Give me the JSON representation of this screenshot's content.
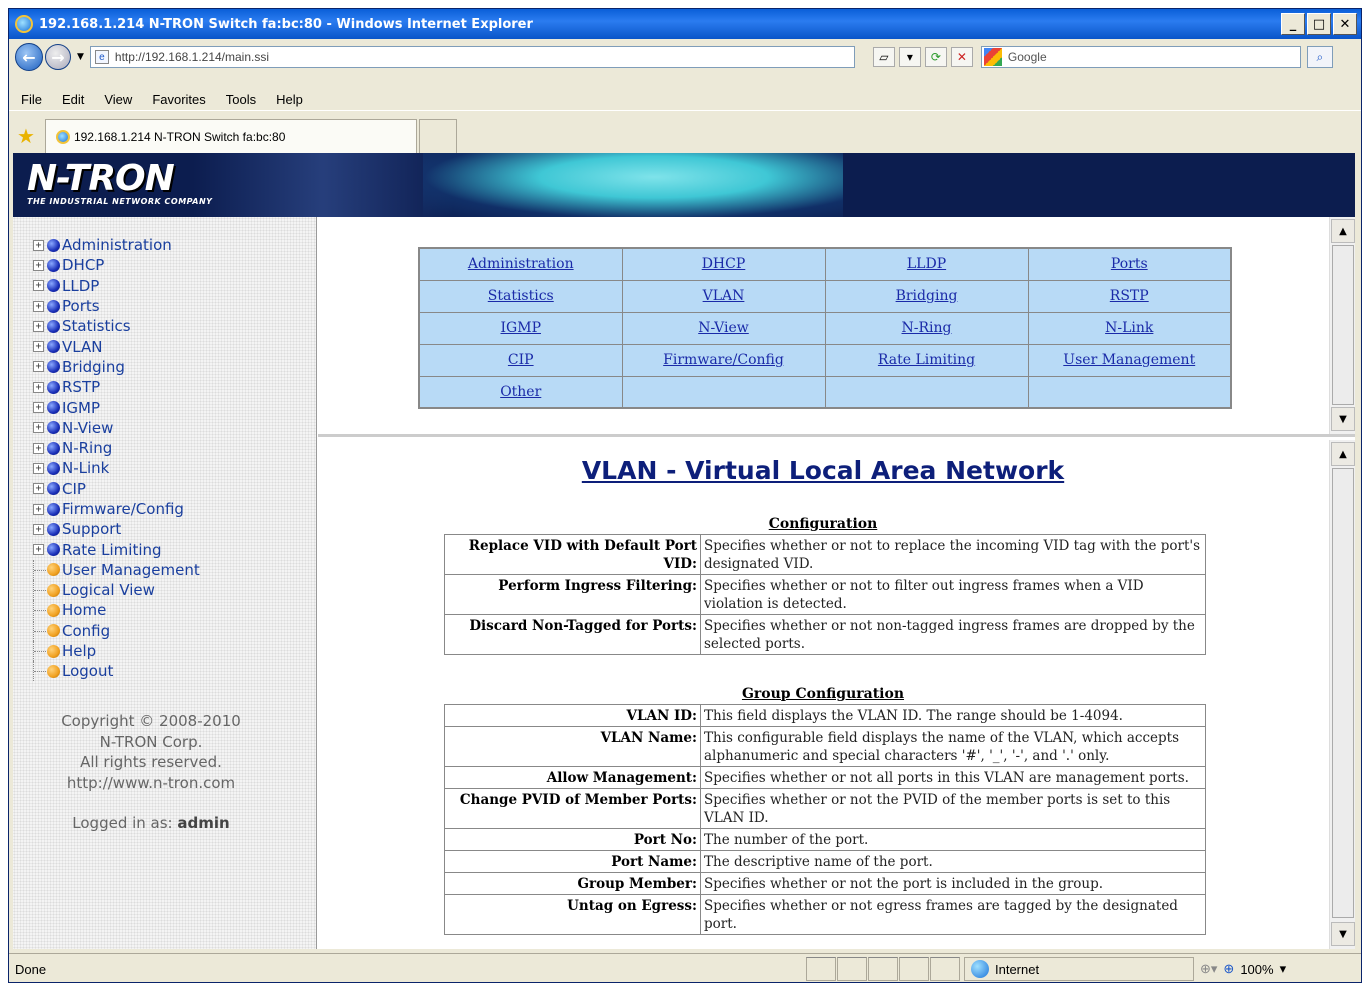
{
  "window": {
    "title": "192.168.1.214 N-TRON Switch fa:bc:80 - Windows Internet Explorer",
    "min_label": "_",
    "max_label": "□",
    "close_label": "✕"
  },
  "addressbar": {
    "back": "←",
    "forward": "→",
    "url": "http://192.168.1.214/main.ssi",
    "search_placeholder": "Google",
    "search_icon": "⌕"
  },
  "menu": [
    "File",
    "Edit",
    "View",
    "Favorites",
    "Tools",
    "Help"
  ],
  "tab": {
    "title": "192.168.1.214 N-TRON Switch fa:bc:80"
  },
  "brand": {
    "name": "N-TRON",
    "tagline": "THE INDUSTRIAL NETWORK COMPANY"
  },
  "sidebar": {
    "items": [
      {
        "label": "Administration",
        "icon": "blue-dot",
        "expandable": true
      },
      {
        "label": "DHCP",
        "icon": "blue-dot",
        "expandable": true
      },
      {
        "label": "LLDP",
        "icon": "blue-dot",
        "expandable": true
      },
      {
        "label": "Ports",
        "icon": "blue-dot",
        "expandable": true
      },
      {
        "label": "Statistics",
        "icon": "blue-dot",
        "expandable": true
      },
      {
        "label": "VLAN",
        "icon": "blue-dot",
        "expandable": true
      },
      {
        "label": "Bridging",
        "icon": "blue-dot",
        "expandable": true
      },
      {
        "label": "RSTP",
        "icon": "blue-dot",
        "expandable": true
      },
      {
        "label": "IGMP",
        "icon": "blue-dot",
        "expandable": true
      },
      {
        "label": "N-View",
        "icon": "blue-dot",
        "expandable": true
      },
      {
        "label": "N-Ring",
        "icon": "blue-dot",
        "expandable": true
      },
      {
        "label": "N-Link",
        "icon": "blue-dot",
        "expandable": true
      },
      {
        "label": "CIP",
        "icon": "blue-dot",
        "expandable": true
      },
      {
        "label": "Firmware/Config",
        "icon": "blue-dot",
        "expandable": true
      },
      {
        "label": "Support",
        "icon": "blue-dot",
        "expandable": true
      },
      {
        "label": "Rate Limiting",
        "icon": "blue-dot",
        "expandable": true
      },
      {
        "label": "User Management",
        "icon": "orange-dot",
        "expandable": false
      },
      {
        "label": "Logical View",
        "icon": "orange-dot",
        "expandable": false
      },
      {
        "label": "Home",
        "icon": "orange-dot",
        "expandable": false
      },
      {
        "label": "Config",
        "icon": "orange-dot",
        "expandable": false
      },
      {
        "label": "Help",
        "icon": "orange-dot",
        "expandable": false
      },
      {
        "label": "Logout",
        "icon": "orange-dot",
        "expandable": false
      }
    ],
    "copyright": "Copyright © 2008-2010",
    "company": "N-TRON Corp.",
    "rights": "All rights reserved.",
    "website": "http://www.n-tron.com",
    "logged_in_prefix": "Logged in as:",
    "logged_in_user": "admin"
  },
  "navtable": {
    "rows": [
      [
        "Administration",
        "DHCP",
        "LLDP",
        "Ports"
      ],
      [
        "Statistics",
        "VLAN",
        "Bridging",
        "RSTP"
      ],
      [
        "IGMP",
        "N-View",
        "N-Ring",
        "N-Link"
      ],
      [
        "CIP",
        "Firmware/Config",
        "Rate Limiting",
        "User Management"
      ],
      [
        "Other",
        "",
        "",
        ""
      ]
    ]
  },
  "help": {
    "title": "VLAN - Virtual Local Area Network",
    "configuration": {
      "heading": "Configuration",
      "rows": [
        {
          "term": "Replace VID with Default Port VID:",
          "desc": "Specifies whether or not to replace the incoming VID tag with the port's designated VID."
        },
        {
          "term": "Perform Ingress Filtering:",
          "desc": "Specifies whether or not to filter out ingress frames when a VID violation is detected."
        },
        {
          "term": "Discard Non-Tagged for Ports:",
          "desc": "Specifies whether or not non-tagged ingress frames are dropped by the selected ports."
        }
      ]
    },
    "group_configuration": {
      "heading": "Group Configuration",
      "rows": [
        {
          "term": "VLAN ID:",
          "desc": "This field displays the VLAN ID. The range should be 1-4094."
        },
        {
          "term": "VLAN Name:",
          "desc": "This configurable field displays the name of the VLAN, which accepts alphanumeric and special characters '#', '_', '-', and '.' only."
        },
        {
          "term": "Allow Management:",
          "desc": "Specifies whether or not all ports in this VLAN are management ports."
        },
        {
          "term": "Change PVID of Member Ports:",
          "desc": "Specifies whether or not the PVID of the member ports is set to this VLAN ID."
        },
        {
          "term": "Port No:",
          "desc": "The number of the port."
        },
        {
          "term": "Port Name:",
          "desc": "The descriptive name of the port."
        },
        {
          "term": "Group Member:",
          "desc": "Specifies whether or not the port is included in the group."
        },
        {
          "term": "Untag on Egress:",
          "desc": "Specifies whether or not egress frames are tagged by the designated port."
        }
      ]
    }
  },
  "statusbar": {
    "status": "Done",
    "zone": "Internet",
    "zoom": "100%"
  },
  "colors": {
    "titlebar": "#0a5fd8",
    "banner": "#0c1d4f",
    "nav_cell": "#b8daf6",
    "link": "#1a2aa8",
    "sidebar_link": "#1a3f9e",
    "heading": "#0d1f7a"
  }
}
